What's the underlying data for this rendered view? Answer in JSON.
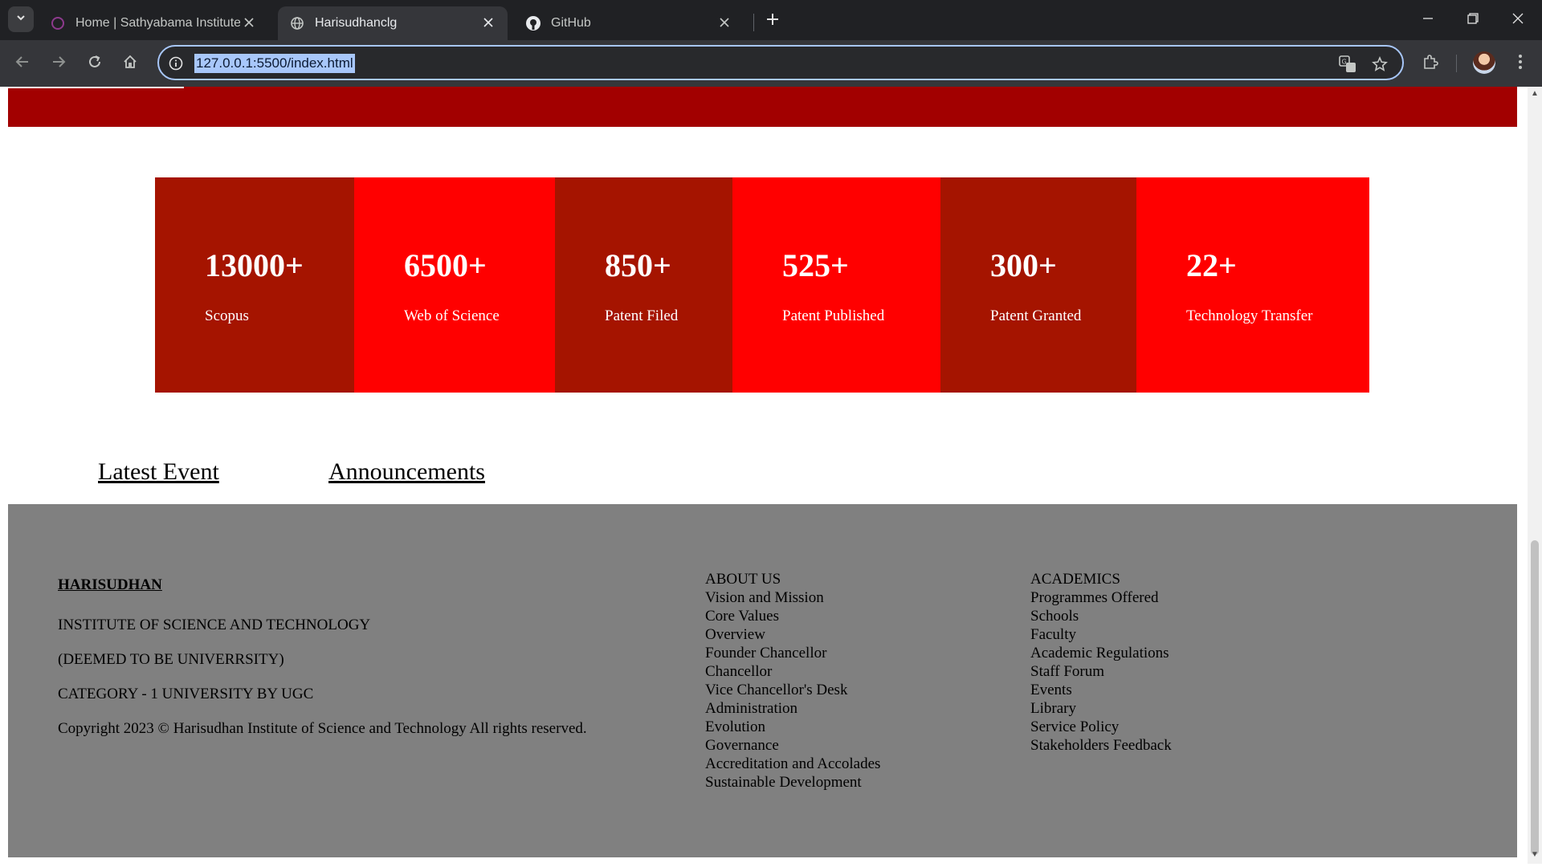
{
  "browser": {
    "tabs": [
      {
        "title": "Home | Sathyabama Institute of",
        "active": false
      },
      {
        "title": "Harisudhanclg",
        "active": true
      },
      {
        "title": "GitHub",
        "active": false
      }
    ],
    "url": "127.0.0.1:5500/index.html"
  },
  "stats": [
    {
      "value": "13000+",
      "label": "Scopus",
      "color": "#a51400"
    },
    {
      "value": "6500+",
      "label": "Web of Science",
      "color": "#ff0000"
    },
    {
      "value": "850+",
      "label": "Patent Filed",
      "color": "#a51400"
    },
    {
      "value": "525+",
      "label": "Patent Published",
      "color": "#ff0000"
    },
    {
      "value": "300+",
      "label": "Patent Granted",
      "color": "#a51400"
    },
    {
      "value": "22+",
      "label": "Technology Transfer",
      "color": "#ff0000"
    }
  ],
  "links": {
    "latest_event": "Latest Event",
    "announcements": "Announcements"
  },
  "footer": {
    "brand": "HARISUDHAN",
    "line1": "INSTITUTE OF SCIENCE AND TECHNOLOGY",
    "line2": "(DEEMED TO BE UNIVERRSITY)",
    "line3": "CATEGORY - 1 UNIVERSITY BY UGC",
    "copyright": "Copyright 2023 © Harisudhan Institute of Science and Technology All rights reserved.",
    "about": {
      "heading": "ABOUT US",
      "items": [
        "Vision and Mission",
        "Core Values",
        "Overview",
        "Founder Chancellor",
        "Chancellor",
        "Vice Chancellor's Desk",
        "Administration",
        "Evolution",
        "Governance",
        "Accreditation and Accolades",
        "Sustainable Development"
      ]
    },
    "academics": {
      "heading": "ACADEMICS",
      "items": [
        "Programmes Offered",
        "Schools",
        "Faculty",
        "Academic Regulations",
        "Staff Forum",
        "Events",
        "Library",
        "Service Policy",
        "Stakeholders Feedback"
      ]
    }
  }
}
